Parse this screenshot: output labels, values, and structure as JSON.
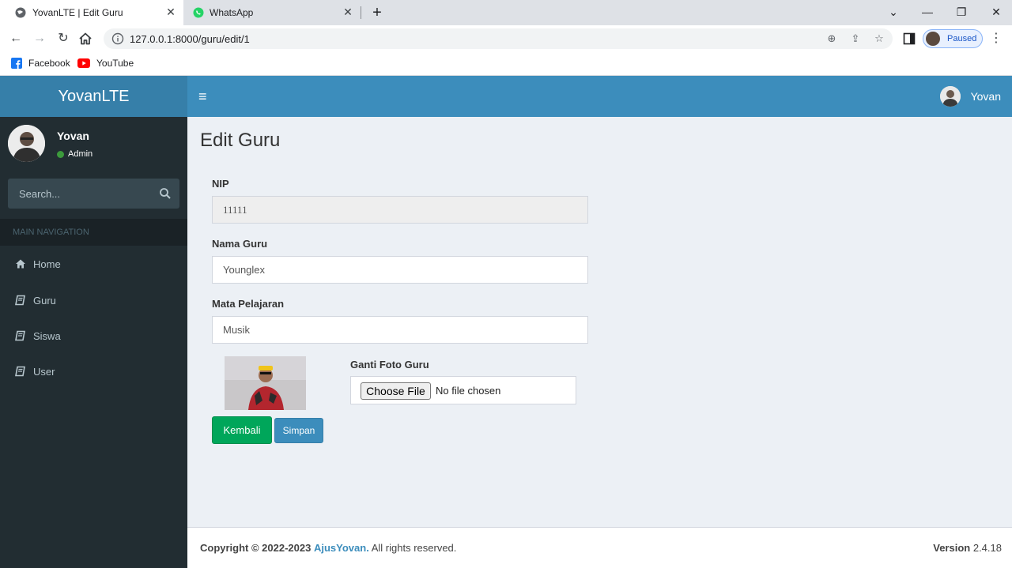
{
  "browser": {
    "tabs": [
      {
        "title": "YovanLTE | Edit Guru",
        "active": true
      },
      {
        "title": "WhatsApp",
        "active": false
      }
    ],
    "url": "127.0.0.1:8000/guru/edit/1",
    "profile_status": "Paused",
    "bookmarks": [
      {
        "label": "Facebook"
      },
      {
        "label": "YouTube"
      }
    ],
    "colors": {
      "whatsapp": "#25d366",
      "facebook": "#1877f2",
      "youtube": "#ff0000"
    }
  },
  "app": {
    "logo": "YovanLTE",
    "navbar": {
      "user_name": "Yovan"
    },
    "sidebar": {
      "user": {
        "name": "Yovan",
        "role": "Admin"
      },
      "search_placeholder": "Search...",
      "nav_header": "MAIN NAVIGATION",
      "items": [
        {
          "label": "Home",
          "icon": "home-icon"
        },
        {
          "label": "Guru",
          "icon": "book-icon"
        },
        {
          "label": "Siswa",
          "icon": "book-icon"
        },
        {
          "label": "User",
          "icon": "book-icon"
        }
      ]
    },
    "page": {
      "title": "Edit Guru",
      "fields": {
        "nip": {
          "label": "NIP",
          "value": "11111"
        },
        "nama": {
          "label": "Nama Guru",
          "value": "Younglex"
        },
        "mapel": {
          "label": "Mata Pelajaran",
          "value": "Musik"
        }
      },
      "file": {
        "label": "Ganti Foto Guru",
        "button": "Choose File",
        "status": "No file chosen"
      },
      "buttons": {
        "back": "Kembali",
        "save": "Simpan"
      }
    },
    "footer": {
      "copyright_prefix": "Copyright © 2022-2023",
      "brand": "AjusYovan.",
      "rights": "All rights reserved.",
      "version_label": "Version",
      "version_value": "2.4.18"
    },
    "colors": {
      "header": "#3c8dbc",
      "logo_bg": "#367fa9",
      "sidebar": "#222d32",
      "success": "#00a65a",
      "online": "#3c9a3c"
    }
  }
}
